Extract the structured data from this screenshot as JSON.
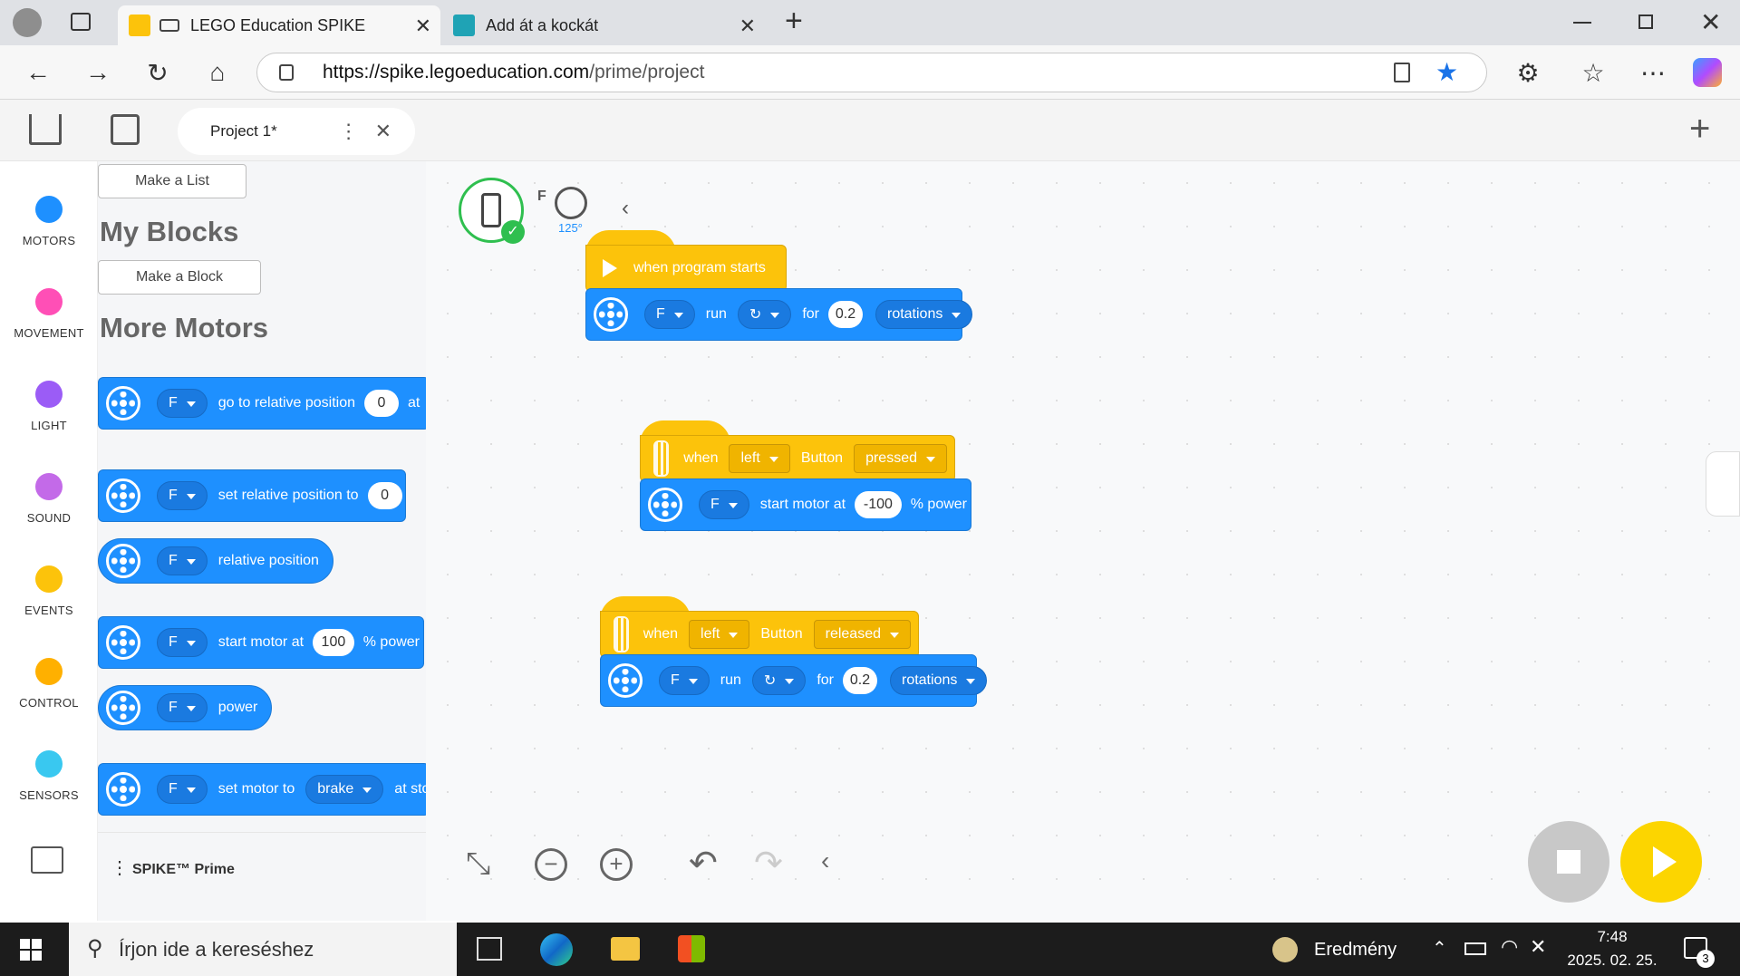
{
  "browser": {
    "tabs": [
      {
        "title": "LEGO Education SPIKE",
        "close": "✕"
      },
      {
        "title": "Add át a kockát",
        "close": "✕"
      }
    ],
    "new_tab": "+",
    "url_host": "https://spike.legoeducation.com",
    "url_path": "/prime/project"
  },
  "app": {
    "project_tab": "Project 1*",
    "add_tab": "+"
  },
  "categories": [
    {
      "label": "MOTORS",
      "color": "#1e90ff"
    },
    {
      "label": "MOVEMENT",
      "color": "#ff4fb6"
    },
    {
      "label": "LIGHT",
      "color": "#9b5cf6"
    },
    {
      "label": "SOUND",
      "color": "#c36ae8"
    },
    {
      "label": "EVENTS",
      "color": "#fcc30b"
    },
    {
      "label": "CONTROL",
      "color": "#ffb000"
    },
    {
      "label": "SENSORS",
      "color": "#39c8f0"
    }
  ],
  "palette": {
    "make_list": "Make a List",
    "my_blocks": "My Blocks",
    "make_block": "Make a Block",
    "more_motors": "More Motors",
    "blocks": {
      "b1": {
        "port": "F",
        "text": "go to relative position",
        "value": "0",
        "tail": "at"
      },
      "b2": {
        "port": "F",
        "text": "set relative position to",
        "value": "0"
      },
      "b3": {
        "port": "F",
        "text": "relative position"
      },
      "b4": {
        "port": "F",
        "text": "start motor at",
        "value": "100",
        "tail": "% power"
      },
      "b5": {
        "port": "F",
        "text": "power"
      },
      "b6": {
        "port": "F",
        "text": "set motor to",
        "mode": "brake",
        "tail": "at stop"
      }
    },
    "footer": "SPIKE™ Prime"
  },
  "canvas": {
    "device": {
      "port": "F",
      "angle": "125°"
    },
    "stack1": {
      "hat": "when program starts",
      "port": "F",
      "run": "run",
      "for": "for",
      "value": "0.2",
      "unit": "rotations"
    },
    "stack2": {
      "when": "when",
      "button": "left",
      "button_lbl": "Button",
      "state": "pressed",
      "port": "F",
      "text": "start motor at",
      "value": "-100",
      "tail": "% power"
    },
    "stack3": {
      "when": "when",
      "button": "left",
      "button_lbl": "Button",
      "state": "released",
      "port": "F",
      "run": "run",
      "for": "for",
      "value": "0.2",
      "unit": "rotations"
    }
  },
  "taskbar": {
    "search_placeholder": "Írjon ide a kereséshez",
    "weather": "Eredmény",
    "time": "7:48",
    "date": "2025. 02. 25.",
    "notifications": "3"
  }
}
